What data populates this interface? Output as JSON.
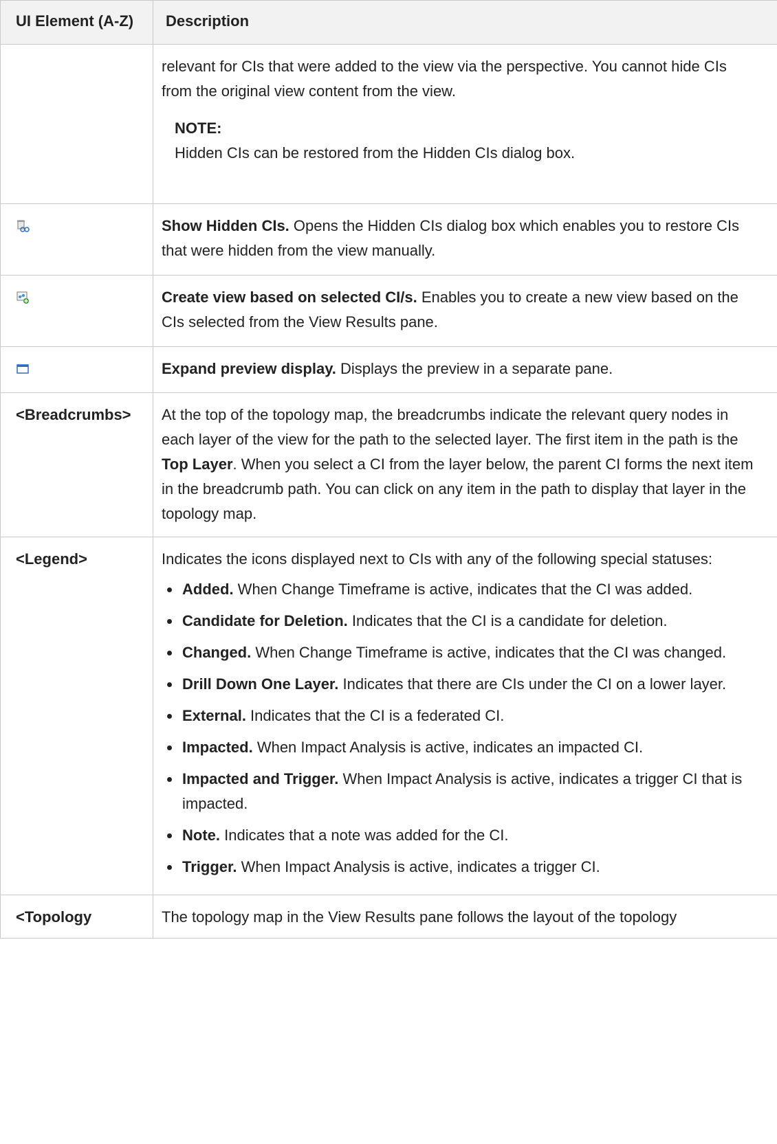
{
  "table": {
    "headers": {
      "col1": "UI Element (A-Z)",
      "col2": "Description"
    },
    "row_hide": {
      "text": "relevant for CIs that were added to the view via the perspective. You cannot hide CIs from the original view content from the view.",
      "note_label": "NOTE:",
      "note_text": "Hidden CIs can be restored from the Hidden CIs dialog box."
    },
    "row_show_hidden": {
      "icon": "show-hidden-cis-icon",
      "title": "Show Hidden CIs.",
      "text": " Opens the Hidden CIs dialog box which enables you to restore CIs that were hidden from the view manually."
    },
    "row_create_view": {
      "icon": "create-view-icon",
      "title": "Create view based on selected CI/s.",
      "text": " Enables you to create a new view based on the CIs selected from the View Results pane."
    },
    "row_expand": {
      "icon": "expand-preview-icon",
      "title": "Expand preview display.",
      "text": " Displays the preview in a separate pane."
    },
    "row_breadcrumbs": {
      "element": "<Breadcrumbs>",
      "text1": "At the top of the topology map, the breadcrumbs indicate the relevant query nodes in each layer of the view for the path to the selected layer. The first item in the path is the ",
      "bold": "Top Layer",
      "text2": ". When you select a CI from the layer below, the parent CI forms the next item in the breadcrumb path. You can click on any item in the path to display that layer in the topology map."
    },
    "row_legend": {
      "element": "<Legend>",
      "intro": "Indicates the icons displayed next to CIs with any of the following special statuses:",
      "items": [
        {
          "title": "Added.",
          "text": " When Change Timeframe is active, indicates that the CI was added."
        },
        {
          "title": "Candidate for Deletion.",
          "text": " Indicates that the CI is a candidate for deletion."
        },
        {
          "title": "Changed.",
          "text": " When Change Timeframe is active, indicates that the CI was changed."
        },
        {
          "title": "Drill Down One Layer.",
          "text": " Indicates that there are CIs under the CI on a lower layer."
        },
        {
          "title": "External.",
          "text": " Indicates that the CI is a federated CI."
        },
        {
          "title": "Impacted.",
          "text": " When Impact Analysis is active, indicates an impacted CI."
        },
        {
          "title": "Impacted and Trigger.",
          "text": " When Impact Analysis is active, indicates a trigger CI that is impacted."
        },
        {
          "title": "Note.",
          "text": " Indicates that a note was added for the CI."
        },
        {
          "title": "Trigger.",
          "text": " When Impact Analysis is active, indicates a trigger CI."
        }
      ]
    },
    "row_topology": {
      "element": "<Topology",
      "text": "The topology map in the View Results pane follows the layout of the topology"
    }
  }
}
